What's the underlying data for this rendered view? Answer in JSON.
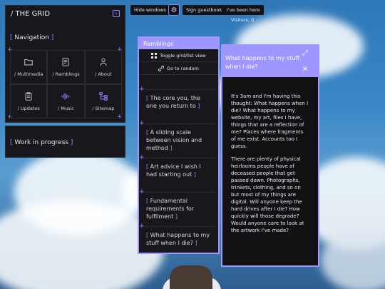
{
  "grid_window": {
    "title": "/ THE GRID",
    "collapse_icon": "‹",
    "nav_heading": "Navigation",
    "nav_items": [
      {
        "label": "/ Multimedia",
        "icon": "folder-icon"
      },
      {
        "label": "/ Ramblings",
        "icon": "document-icon"
      },
      {
        "label": "/ About",
        "icon": "user-icon"
      },
      {
        "label": "/ Updates",
        "icon": "clipboard-icon"
      },
      {
        "label": "/ Music",
        "icon": "audio-wave-icon"
      },
      {
        "label": "/ Sitemap",
        "icon": "sitemap-icon"
      }
    ]
  },
  "wip_window": {
    "title": "Work in progress"
  },
  "top_bar": {
    "hide_windows": "Hide windows",
    "settings_icon": "gear-icon",
    "sign_guestbook": "Sign guestbook",
    "been_here": "I've been here",
    "visitors": "Visitors: 0"
  },
  "ramblings": {
    "title": "Ramblings",
    "toggle_label": "Toggle grid/list view",
    "random_label": "Go to random",
    "items": [
      "The core you, the one you return to",
      "A sliding scale between vision and method",
      "Art advice I wish I had starting out",
      "Fundamental requirements for fulfilment",
      "What happens to my stuff when I die?"
    ]
  },
  "article": {
    "title": "What happens to my stuff when I die?",
    "paragraphs": [
      "It's 3am and I'm having this thought: What happens when I die? What happens to my website, my art, files I have, things that are a reflection of me? Places where fragments of me exist. Accounts too I guess.",
      "There are plenty of physical heirlooms people have of deceased people that get passed down. Photographs, trinkets, clothing, and so on but most of my things are digital. Will anyone keep the hard drives after I die? How quickly will those degrade? Would anyone care to look at the artwork I've made?"
    ]
  },
  "colors": {
    "accent": "#9f97ff",
    "panel": "#17171c"
  }
}
